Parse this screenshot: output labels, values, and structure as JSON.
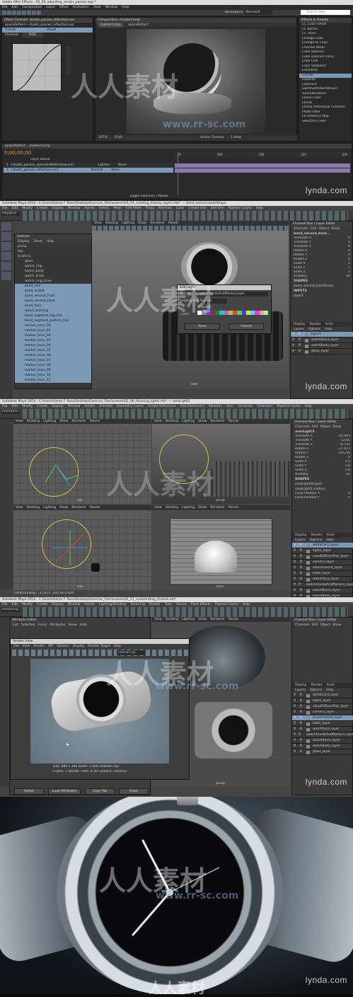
{
  "ae": {
    "title": "Adobe After Effects - 05_09_adjusting_render_passes.aep *",
    "menu": [
      "File",
      "Edit",
      "Composition",
      "Layer",
      "Effect",
      "Animation",
      "View",
      "Window",
      "Help"
    ],
    "workspace_label": "Workspace:",
    "workspace_value": "Standard",
    "search_placeholder": "Search Help",
    "effects_panel_title": "Effect Controls: studio_passes_reflection.exr",
    "effects_subtitle": "spaceReflect • studio_passes_reflection.exr",
    "curves_label": "Curves",
    "reset_label": "Reset",
    "channel_label": "Channel:",
    "channel_value": "RGB",
    "comp_tab": "Composition: masterComp",
    "comp_subtabs": [
      "masterComp",
      "spaceReflect"
    ],
    "effects_presets_title": "Effects & Presets",
    "effects_list": [
      "CC Color Offset",
      "CC Kernel",
      "CC Toner",
      "Change Color",
      "Change to Color",
      "Channel Mixer",
      "Color Balance",
      "Color Balance (HLS)",
      "Color Link",
      "Color Stabilizer",
      "Colorama",
      "Curves",
      "Equalize",
      "Exposure",
      "Gamma/Pedestal/Gain",
      "Hue/Saturation",
      "Leave Color",
      "Levels",
      "Levels (Individual Controls)",
      "Photo Filter",
      "PS Arbitrary Map",
      "Selective Color"
    ],
    "effects_selected_index": 11,
    "zoom_value": "107%",
    "view_value": "(Full)",
    "active_camera": "Active Camera",
    "view_count": "1 View",
    "timeline_tabs": [
      "spaceReflect",
      "masterComp"
    ],
    "timecode": "0;00;00;00",
    "layer_header": "Layer Name",
    "layers": [
      {
        "num": "1",
        "name": "[studio_passes_specularNoShadow.exr]",
        "mode": "Lighten"
      },
      {
        "num": "2",
        "name": "[studio_passes_reflection.exr]",
        "mode": "Normal"
      }
    ],
    "none_label": "None",
    "toggle_label": "Toggle Switches / Modes",
    "ruler_ticks": [
      "0f",
      "05f",
      "10f",
      "15f",
      "20f"
    ]
  },
  "maya1": {
    "title": "Autodesk Maya 2014 - C:\\Users\\Aaron F. Ross\\Desktop\\Exercise_Files\\scenes\\03_03_creating_display_layers.mb* --- band_second_backShape",
    "menu": [
      "File",
      "Edit",
      "Modify",
      "Create",
      "Display",
      "Window",
      "Assets",
      "Select",
      "Mesh",
      "Edit Mesh",
      "Proxy",
      "Normals",
      "Color",
      "Create UVs",
      "Edit UVs",
      "Pipeline Cache",
      "Help"
    ],
    "mode": "Polygons",
    "outliner_title": "Outliner",
    "outliner_menu": [
      "Display",
      "Show",
      "Help"
    ],
    "outliner_items": [
      "persp",
      "top",
      "locator1",
      "glass",
      "watch_ring",
      "watch_body",
      "watch_knob",
      "watch_ring_inner",
      "band_rear",
      "band_visible",
      "band_second_front",
      "band_second_back",
      "band_face",
      "watch_backing",
      "band_segment_top_link",
      "band_segment_bottom_link",
      "marker_hour_00",
      "marker_hour_01",
      "marker_hour_02",
      "marker_hour_03",
      "marker_hour_04",
      "marker_hour_05",
      "marker_hour_06",
      "marker_hour_07",
      "marker_hour_08",
      "marker_hour_09",
      "marker_hour_10",
      "marker_hour_11"
    ],
    "viewport_menu": [
      "View",
      "Shading",
      "Lighting",
      "Show",
      "Renderer",
      "Panels"
    ],
    "dialog_title": "Edit Layer",
    "dialog_name_label": "Name:",
    "dialog_name_value": "watchHandsAndMarkerLayer",
    "dialog_display_label": "Display type:",
    "dialog_display_value": "Normal",
    "dialog_visible_label": "Visible",
    "dialog_color_label": "Color:",
    "dialog_save": "Save",
    "dialog_cancel": "Cancel",
    "cb_title": "Channel Box / Layer Editor",
    "cb_menu": [
      "Channels",
      "Edit",
      "Object",
      "Show"
    ],
    "cb_object": "band_second_back...",
    "cb_attrs": [
      "Translate X",
      "Translate Y",
      "Translate Z",
      "Rotate X",
      "Rotate Y",
      "Rotate Z",
      "Scale X",
      "Scale Y",
      "Scale Z",
      "Visibility"
    ],
    "cb_vals": [
      "0",
      "0",
      "0",
      "0",
      "0",
      "0",
      "1",
      "1",
      "1",
      "on"
    ],
    "shapes_label": "SHAPES",
    "shape_name": "band_second_backShape",
    "inputs_label": "INPUTS",
    "input_name": "layer1",
    "layer_tabs": [
      "Display",
      "Render",
      "Anim"
    ],
    "layer_menu": [
      "Layers",
      "Options",
      "Help"
    ],
    "layer_list": [
      "layer1",
      "watchBand_layer",
      "watchBody_layer",
      "glass_layer"
    ],
    "persp_label": "persp",
    "side_label": "side"
  },
  "maya2": {
    "title": "Autodesk Maya 2014 - C:\\Users\\Aaron F. Ross\\Desktop\\Exercise_Files\\scenes\\02_06_focusing_lights.mb* --- areaLight3",
    "menu": [
      "File",
      "Edit",
      "Modify",
      "Create",
      "Display",
      "Window",
      "Assets",
      "Animate",
      "Geometry Cache",
      "Create Deformers",
      "Edit Deformers",
      "Skeleton",
      "Skin",
      "Constrain",
      "Character",
      "Pipeline Cache",
      "Help"
    ],
    "mode": "Animation",
    "viewport_menu": [
      "View",
      "Shading",
      "Lighting",
      "Show",
      "Renderer",
      "Panels"
    ],
    "cb_title": "Channel Box / Layer Editor",
    "cb_menu": [
      "Channels",
      "Edit",
      "Object",
      "Show"
    ],
    "cb_object": "areaLight3",
    "cb_attrs": [
      "Translate X",
      "Translate Y",
      "Translate Z",
      "Rotate X",
      "Rotate Y",
      "Rotate Z",
      "Scale X",
      "Scale Y",
      "Scale Z",
      "Visibility"
    ],
    "cb_vals": [
      "-25.993",
      "12.65",
      "-8.751",
      "-37.671",
      "-105.94",
      "0",
      "2.6",
      "2.6",
      "2.6",
      "on"
    ],
    "shapes_label": "SHAPES",
    "shape_names": [
      "areaLightShape3",
      "areaLight3_matLoc"
    ],
    "loc_attrs": [
      "Local Position X",
      "Local Position Y"
    ],
    "loc_vals": [
      "0",
      "0"
    ],
    "layer_tabs": [
      "Display",
      "Render",
      "Anim"
    ],
    "layer_menu": [
      "Layers",
      "Options",
      "Help"
    ],
    "layer_list": [
      "whiteCard_layer",
      "lights_layer",
      "cloudDiffuseText_layer",
      "camera_layer",
      "environment_layer",
      "table_layer",
      "watchFace_layer",
      "watchHandsAndMarkers_layer",
      "watchBand_layer",
      "watchBody_layer",
      "glass_layer"
    ],
    "status": "Rotation(deg): -37.671 -105.94 0.000",
    "top_label": "top",
    "persp_label": "persp",
    "side_label": "side",
    "front_label": "front"
  },
  "maya3": {
    "title": "Autodesk Maya 2014 - C:\\Users\\Aaron F. Ross\\Desktop\\Exercise_Files\\scenes\\02_11_customizing_chrome.mb*",
    "menu": [
      "File",
      "Edit",
      "Modify",
      "Create",
      "Display",
      "Window",
      "Assets",
      "Lighting/Shading",
      "Texturing",
      "Render",
      "Toon",
      "Stereo",
      "Paint Effects",
      "Pipeline Cache",
      "Help"
    ],
    "mode": "Rendering",
    "ae_title": "Attribute Editor",
    "ae_menu": [
      "List",
      "Selected",
      "Focus",
      "Attributes",
      "Show",
      "Help"
    ],
    "rv_title": "Render View",
    "rv_menu": [
      "File",
      "View",
      "Render",
      "IPR",
      "Options",
      "Display",
      "Render Target",
      "Help"
    ],
    "rv_preset": "normal ray",
    "rv_info": [
      "size: 480 x 360 zoom: 1.000   (mental ray)",
      "Frame: 1    Render Time: 0:30    Camera: camera1"
    ],
    "bottom_buttons": [
      "Select",
      "Load Attributes",
      "Copy Tab",
      "Close"
    ],
    "cb_title": "Channel Box / Layer Editor",
    "cb_menu": [
      "Channels",
      "Edit",
      "Object",
      "Show"
    ],
    "layer_tabs": [
      "Display",
      "Render",
      "Anim"
    ],
    "layer_menu": [
      "Layers",
      "Options",
      "Help"
    ],
    "layer_list": [
      "whiteCard_layer",
      "lights_layer",
      "cloudDiffuseText_layer",
      "camera_layer",
      "environment_layer",
      "table_layer",
      "watchFace_layer",
      "watchHandsAndMarkers_layer",
      "watchBand_layer",
      "watchBody_layer",
      "glass_layer"
    ],
    "layer_selected_index": 4,
    "persp_label": "persp"
  },
  "brand": {
    "lynda": "lynda.com",
    "watermark_cn": "人人素材",
    "watermark_url": "www.rr-sc.com"
  },
  "colors": {
    "maya_select": "#7d99b8",
    "ae_purple": "#8c7aa8",
    "swatch_row": [
      "#ffffff",
      "#888888",
      "#4d4dff",
      "#a02050",
      "#208040",
      "#30c0c0",
      "#c060c0",
      "#c0c030",
      "#e04040",
      "#40e040",
      "#4040e0",
      "#e0e040",
      "#40e0e0",
      "#e040e0",
      "#ffa0a0",
      "#a0ffa0"
    ]
  }
}
